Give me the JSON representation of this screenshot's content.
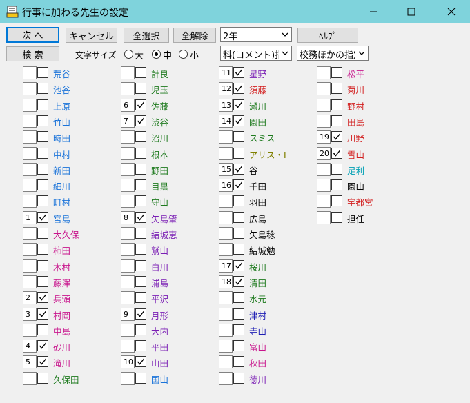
{
  "window": {
    "title": "行事に加わる先生の設定"
  },
  "toolbar": {
    "next_label": "次 へ",
    "cancel_label": "キャンセル",
    "select_all_label": "全選択",
    "clear_all_label": "全解除",
    "grade_select": "2年",
    "help_label": "ﾍﾙﾌﾟ",
    "search_label": "検 索",
    "font_size_label": "文字サイズ",
    "font_large": "大",
    "font_medium": "中",
    "font_small": "小",
    "subject_select": "科(コメント)指定",
    "affairs_select": "校務ほかの指定"
  },
  "colors": {
    "accent": "#0078d7",
    "titlebar": "#7fd3dc",
    "blue": "#1a73d9",
    "magenta": "#c8148c",
    "green": "#1e7a1e",
    "purple": "#7a1eb4",
    "red": "#d21e1e",
    "olive": "#808000",
    "teal": "#00a0b4"
  },
  "teachers": [
    {
      "num": "",
      "checked": false,
      "name": "荒谷",
      "color": "#1a73d9"
    },
    {
      "num": "",
      "checked": false,
      "name": "池谷",
      "color": "#1a73d9"
    },
    {
      "num": "",
      "checked": false,
      "name": "上原",
      "color": "#1a73d9"
    },
    {
      "num": "",
      "checked": false,
      "name": "竹山",
      "color": "#1a73d9"
    },
    {
      "num": "",
      "checked": false,
      "name": "時田",
      "color": "#1a73d9"
    },
    {
      "num": "",
      "checked": false,
      "name": "中村",
      "color": "#1a73d9"
    },
    {
      "num": "",
      "checked": false,
      "name": "新田",
      "color": "#1a73d9"
    },
    {
      "num": "",
      "checked": false,
      "name": "細川",
      "color": "#1a73d9"
    },
    {
      "num": "",
      "checked": false,
      "name": "町村",
      "color": "#1a73d9"
    },
    {
      "num": "1",
      "checked": true,
      "name": "宮島",
      "color": "#1a73d9"
    },
    {
      "num": "",
      "checked": false,
      "name": "大久保",
      "color": "#c8148c"
    },
    {
      "num": "",
      "checked": false,
      "name": "柿田",
      "color": "#c8148c"
    },
    {
      "num": "",
      "checked": false,
      "name": "木村",
      "color": "#c8148c"
    },
    {
      "num": "",
      "checked": false,
      "name": "藤澤",
      "color": "#c8148c"
    },
    {
      "num": "2",
      "checked": true,
      "name": "兵頭",
      "color": "#c8148c"
    },
    {
      "num": "3",
      "checked": true,
      "name": "村岡",
      "color": "#c8148c"
    },
    {
      "num": "",
      "checked": false,
      "name": "中島",
      "color": "#c8148c"
    },
    {
      "num": "4",
      "checked": true,
      "name": "砂川",
      "color": "#c8148c"
    },
    {
      "num": "5",
      "checked": true,
      "name": "滝川",
      "color": "#c8148c"
    },
    {
      "num": "",
      "checked": false,
      "name": "久保田",
      "color": "#1e7a1e"
    },
    {
      "num": "",
      "checked": false,
      "name": "計良",
      "color": "#1e7a1e"
    },
    {
      "num": "",
      "checked": false,
      "name": "児玉",
      "color": "#1e7a1e"
    },
    {
      "num": "6",
      "checked": true,
      "name": "佐藤",
      "color": "#1e7a1e"
    },
    {
      "num": "7",
      "checked": true,
      "name": "渋谷",
      "color": "#1e7a1e"
    },
    {
      "num": "",
      "checked": false,
      "name": "沼川",
      "color": "#1e7a1e"
    },
    {
      "num": "",
      "checked": false,
      "name": "根本",
      "color": "#1e7a1e"
    },
    {
      "num": "",
      "checked": false,
      "name": "野田",
      "color": "#1e7a1e"
    },
    {
      "num": "",
      "checked": false,
      "name": "目黒",
      "color": "#1e7a1e"
    },
    {
      "num": "",
      "checked": false,
      "name": "守山",
      "color": "#1e7a1e"
    },
    {
      "num": "8",
      "checked": true,
      "name": "矢島肇",
      "color": "#7a1eb4"
    },
    {
      "num": "",
      "checked": false,
      "name": "結城恵",
      "color": "#7a1eb4"
    },
    {
      "num": "",
      "checked": false,
      "name": "鷲山",
      "color": "#7a1eb4"
    },
    {
      "num": "",
      "checked": false,
      "name": "白川",
      "color": "#7a1eb4"
    },
    {
      "num": "",
      "checked": false,
      "name": "浦島",
      "color": "#7a1eb4"
    },
    {
      "num": "",
      "checked": false,
      "name": "平沢",
      "color": "#7a1eb4"
    },
    {
      "num": "9",
      "checked": true,
      "name": "月形",
      "color": "#7a1eb4"
    },
    {
      "num": "",
      "checked": false,
      "name": "大内",
      "color": "#7a1eb4"
    },
    {
      "num": "",
      "checked": false,
      "name": "平田",
      "color": "#7a1eb4"
    },
    {
      "num": "10",
      "checked": true,
      "name": "山田",
      "color": "#7a1eb4"
    },
    {
      "num": "",
      "checked": false,
      "name": "国山",
      "color": "#1a73d9"
    },
    {
      "num": "11",
      "checked": true,
      "name": "星野",
      "color": "#7a1eb4"
    },
    {
      "num": "12",
      "checked": true,
      "name": "須藤",
      "color": "#d21e1e"
    },
    {
      "num": "13",
      "checked": true,
      "name": "瀬川",
      "color": "#1e7a1e"
    },
    {
      "num": "14",
      "checked": true,
      "name": "園田",
      "color": "#1e7a1e"
    },
    {
      "num": "",
      "checked": false,
      "name": "スミス",
      "color": "#1e7a1e"
    },
    {
      "num": "",
      "checked": false,
      "name": "アリス・I",
      "color": "#808000"
    },
    {
      "num": "15",
      "checked": true,
      "name": "谷",
      "color": "#000000"
    },
    {
      "num": "16",
      "checked": true,
      "name": "千田",
      "color": "#000000"
    },
    {
      "num": "",
      "checked": false,
      "name": "羽田",
      "color": "#000000"
    },
    {
      "num": "",
      "checked": false,
      "name": "広島",
      "color": "#000000"
    },
    {
      "num": "",
      "checked": false,
      "name": "矢島稔",
      "color": "#000000"
    },
    {
      "num": "",
      "checked": false,
      "name": "結城勉",
      "color": "#000000"
    },
    {
      "num": "17",
      "checked": true,
      "name": "桜川",
      "color": "#1e7a1e"
    },
    {
      "num": "18",
      "checked": true,
      "name": "清田",
      "color": "#1e7a1e"
    },
    {
      "num": "",
      "checked": false,
      "name": "水元",
      "color": "#1e7a1e"
    },
    {
      "num": "",
      "checked": false,
      "name": "津村",
      "color": "#1e1eb4"
    },
    {
      "num": "",
      "checked": false,
      "name": "寺山",
      "color": "#1e1eb4"
    },
    {
      "num": "",
      "checked": false,
      "name": "富山",
      "color": "#c8148c"
    },
    {
      "num": "",
      "checked": false,
      "name": "秋田",
      "color": "#c8148c"
    },
    {
      "num": "",
      "checked": false,
      "name": "徳川",
      "color": "#7a1eb4"
    },
    {
      "num": "",
      "checked": false,
      "name": "松平",
      "color": "#c8148c"
    },
    {
      "num": "",
      "checked": false,
      "name": "菊川",
      "color": "#d21e1e"
    },
    {
      "num": "",
      "checked": false,
      "name": "野村",
      "color": "#d21e1e"
    },
    {
      "num": "",
      "checked": false,
      "name": "田島",
      "color": "#d21e1e"
    },
    {
      "num": "19",
      "checked": true,
      "name": "川野",
      "color": "#d21e1e"
    },
    {
      "num": "20",
      "checked": true,
      "name": "雪山",
      "color": "#d21e1e"
    },
    {
      "num": "",
      "checked": false,
      "name": "足利",
      "color": "#00a0b4"
    },
    {
      "num": "",
      "checked": false,
      "name": "園山",
      "color": "#000000"
    },
    {
      "num": "",
      "checked": false,
      "name": "宇都宮",
      "color": "#d21e1e"
    },
    {
      "num": "",
      "checked": false,
      "name": "担任",
      "color": "#000000"
    }
  ]
}
